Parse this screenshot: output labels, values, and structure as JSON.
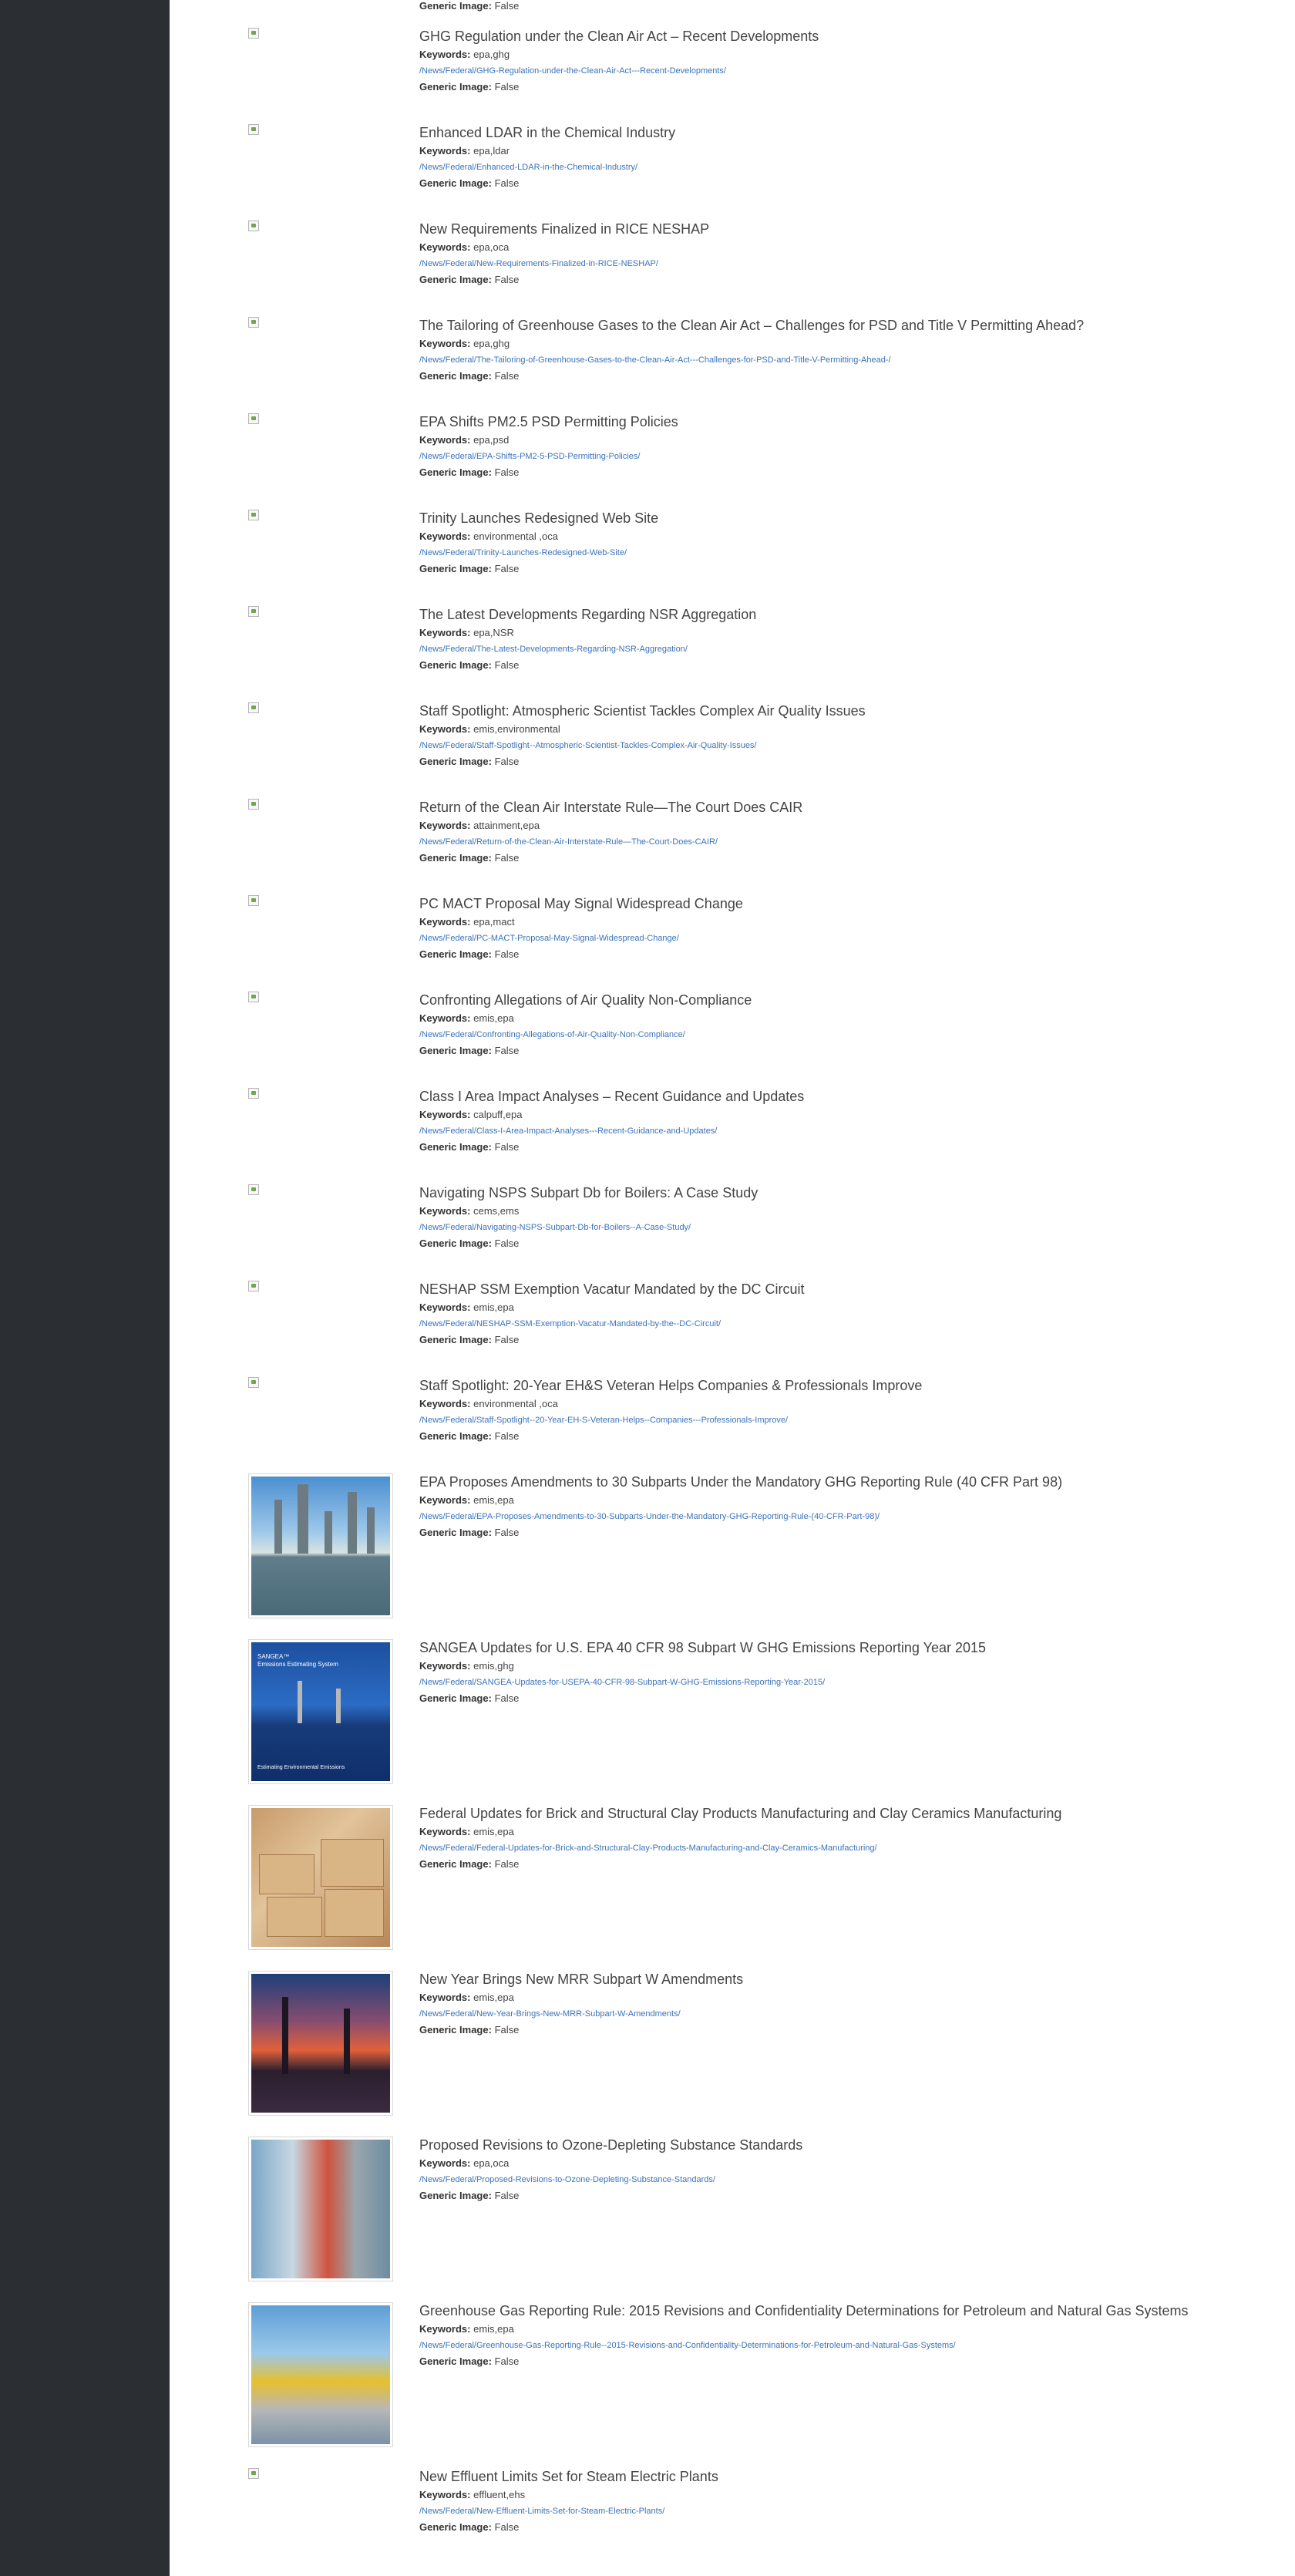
{
  "labels": {
    "keywords": "Keywords:",
    "generic": "Generic Image:"
  },
  "top_generic_value": "False",
  "items": [
    {
      "title": "GHG Regulation under the Clean Air Act – Recent Developments",
      "keywords": "epa,ghg",
      "url": "/News/Federal/GHG-Regulation-under-the-Clean-Air-Act---Recent-Developments/",
      "generic": "False"
    },
    {
      "title": "Enhanced LDAR in the Chemical Industry",
      "keywords": "epa,ldar",
      "url": "/News/Federal/Enhanced-LDAR-in-the-Chemical-Industry/",
      "generic": "False"
    },
    {
      "title": "New Requirements Finalized in RICE NESHAP",
      "keywords": "epa,oca",
      "url": "/News/Federal/New-Requirements-Finalized-in-RICE-NESHAP/",
      "generic": "False"
    },
    {
      "title": "The Tailoring of Greenhouse Gases to the Clean Air Act – Challenges for PSD and Title V Permitting Ahead?",
      "keywords": "epa,ghg",
      "url": "/News/Federal/The-Tailoring-of-Greenhouse-Gases-to-the-Clean-Air-Act---Challenges-for-PSD-and-Title-V-Permitting-Ahead-/",
      "generic": "False"
    },
    {
      "title": "EPA Shifts PM2.5 PSD Permitting Policies",
      "keywords": "epa,psd",
      "url": "/News/Federal/EPA-Shifts-PM2-5-PSD-Permitting-Policies/",
      "generic": "False"
    },
    {
      "title": "Trinity Launches Redesigned Web Site",
      "keywords": "environmental ,oca",
      "url": "/News/Federal/Trinity-Launches-Redesigned-Web-Site/",
      "generic": "False"
    },
    {
      "title": "The Latest Developments Regarding NSR Aggregation",
      "keywords": "epa,NSR",
      "url": "/News/Federal/The-Latest-Developments-Regarding-NSR-Aggregation/",
      "generic": "False"
    },
    {
      "title": "Staff Spotlight: Atmospheric Scientist Tackles Complex Air Quality Issues",
      "keywords": "emis,environmental",
      "url": "/News/Federal/Staff-Spotlight--Atmospheric-Scientist-Tackles-Complex-Air-Quality-Issues/",
      "generic": "False"
    },
    {
      "title": "Return of the Clean Air Interstate Rule—The Court Does CAIR",
      "keywords": "attainment,epa",
      "url": "/News/Federal/Return-of-the-Clean-Air-Interstate-Rule—The-Court-Does-CAIR/",
      "generic": "False"
    },
    {
      "title": "PC MACT Proposal May Signal Widespread Change",
      "keywords": "epa,mact",
      "url": "/News/Federal/PC-MACT-Proposal-May-Signal-Widespread-Change/",
      "generic": "False"
    },
    {
      "title": "Confronting Allegations of Air Quality Non-Compliance",
      "keywords": "emis,epa",
      "url": "/News/Federal/Confronting-Allegations-of-Air-Quality-Non-Compliance/",
      "generic": "False"
    },
    {
      "title": "Class I Area Impact Analyses – Recent Guidance and Updates",
      "keywords": "calpuff,epa",
      "url": "/News/Federal/Class-I-Area-Impact-Analyses---Recent-Guidance-and-Updates/",
      "generic": "False"
    },
    {
      "title": "Navigating NSPS Subpart Db for Boilers: A Case Study",
      "keywords": "cems,ems",
      "url": "/News/Federal/Navigating-NSPS-Subpart-Db-for-Boilers--A-Case-Study/",
      "generic": "False"
    },
    {
      "title": "NESHAP SSM Exemption Vacatur Mandated by the DC Circuit",
      "keywords": "emis,epa",
      "url": "/News/Federal/NESHAP-SSM-Exemption-Vacatur-Mandated-by-the--DC-Circuit/",
      "generic": "False"
    },
    {
      "title": "Staff Spotlight: 20-Year EH&S Veteran Helps Companies & Professionals Improve",
      "keywords": "environmental ,oca",
      "url": "/News/Federal/Staff-Spotlight--20-Year-EH-S-Veteran-Helps--Companies---Professionals-Improve/",
      "generic": "False"
    },
    {
      "title": "EPA Proposes Amendments to 30 Subparts Under the Mandatory GHG Reporting Rule (40 CFR Part 98)",
      "keywords": "emis,epa",
      "url": "/News/Federal/EPA-Proposes-Amendments-to-30-Subparts-Under-the-Mandatory-GHG-Reporting-Rule-(40-CFR-Part-98)/",
      "generic": "False"
    },
    {
      "title": "SANGEA Updates for U.S. EPA 40 CFR 98 Subpart W GHG Emissions Reporting Year 2015",
      "keywords": "emis,ghg",
      "url": "/News/Federal/SANGEA-Updates-for-USEPA-40-CFR-98-Subpart-W-GHG-Emissions-Reporting-Year-2015/",
      "generic": "False"
    },
    {
      "title": "Federal Updates for Brick and Structural Clay Products Manufacturing and Clay Ceramics Manufacturing",
      "keywords": "emis,epa",
      "url": "/News/Federal/Federal-Updates-for-Brick-and-Structural-Clay-Products-Manufacturing-and-Clay-Ceramics-Manufacturing/",
      "generic": "False"
    },
    {
      "title": "New Year Brings New MRR Subpart W Amendments",
      "keywords": "emis,epa",
      "url": "/News/Federal/New-Year-Brings-New-MRR-Subpart-W-Amendments/",
      "generic": "False"
    },
    {
      "title": "Proposed Revisions to Ozone-Depleting Substance Standards",
      "keywords": "epa,oca",
      "url": "/News/Federal/Proposed-Revisions-to-Ozone-Depleting-Substance-Standards/",
      "generic": "False"
    },
    {
      "title": "Greenhouse Gas Reporting Rule: 2015 Revisions and Confidentiality Determinations for Petroleum and Natural Gas Systems",
      "keywords": "emis,epa",
      "url": "/News/Federal/Greenhouse-Gas-Reporting-Rule--2015-Revisions-and-Confidentiality-Determinations-for-Petroleum-and-Natural-Gas-Systems/",
      "generic": "False"
    },
    {
      "title": "New Effluent Limits Set for Steam Electric Plants",
      "keywords": "effluent,ehs",
      "url": "/News/Federal/New-Effluent-Limits-Set-for-Steam-Electric-Plants/",
      "generic": "False"
    }
  ],
  "sangea_image_text": {
    "top": "SANGEA™",
    "sub": "Emissions Estimating System",
    "bottom": "Estimating Environmental Emissions"
  }
}
